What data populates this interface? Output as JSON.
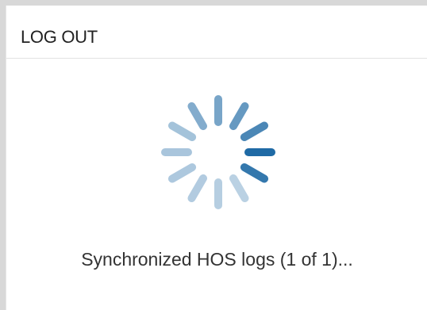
{
  "dialog": {
    "title": "LOG OUT",
    "status_text": "Synchronized HOS logs (1 of 1)..."
  },
  "spinner": {
    "icon": "loading-spinner-icon",
    "color": "#1f6aa5"
  }
}
